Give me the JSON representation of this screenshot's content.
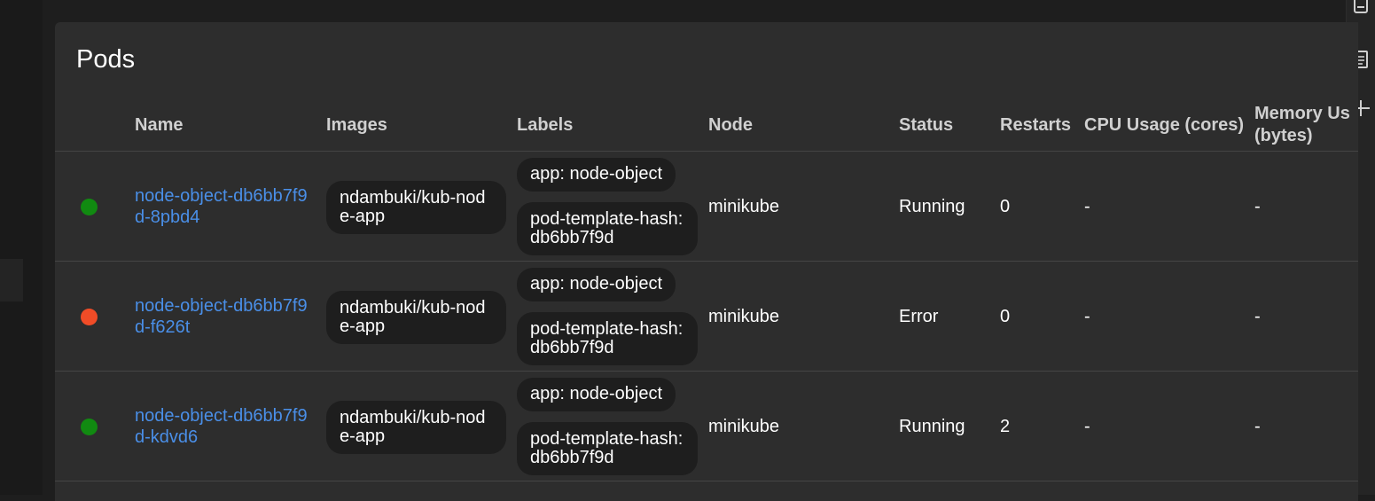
{
  "panel": {
    "title": "Pods"
  },
  "columns": {
    "name": "Name",
    "images": "Images",
    "labels": "Labels",
    "node": "Node",
    "status": "Status",
    "restarts": "Restarts",
    "cpu": "CPU Usage (cores)",
    "memory": "Memory Us\n(bytes)"
  },
  "colors": {
    "running": "#118a11",
    "error": "#f14c27",
    "link": "#4a8fe8"
  },
  "pods": [
    {
      "name": "node-object-db6bb7f9d-8pbd4",
      "status_icon": "green-status-dot-icon",
      "image": "ndambuki/kub-node-app",
      "labels": [
        "app: node-object",
        "pod-template-hash: db6bb7f9d"
      ],
      "node": "minikube",
      "status": "Running",
      "restarts": "0",
      "cpu": "-",
      "memory": "-"
    },
    {
      "name": "node-object-db6bb7f9d-f626t",
      "status_icon": "red-status-dot-icon",
      "image": "ndambuki/kub-node-app",
      "labels": [
        "app: node-object",
        "pod-template-hash: db6bb7f9d"
      ],
      "node": "minikube",
      "status": "Error",
      "restarts": "0",
      "cpu": "-",
      "memory": "-"
    },
    {
      "name": "node-object-db6bb7f9d-kdvd6",
      "status_icon": "green-status-dot-icon",
      "image": "ndambuki/kub-node-app",
      "labels": [
        "app: node-object",
        "pod-template-hash: db6bb7f9d"
      ],
      "node": "minikube",
      "status": "Running",
      "restarts": "2",
      "cpu": "-",
      "memory": "-"
    }
  ]
}
